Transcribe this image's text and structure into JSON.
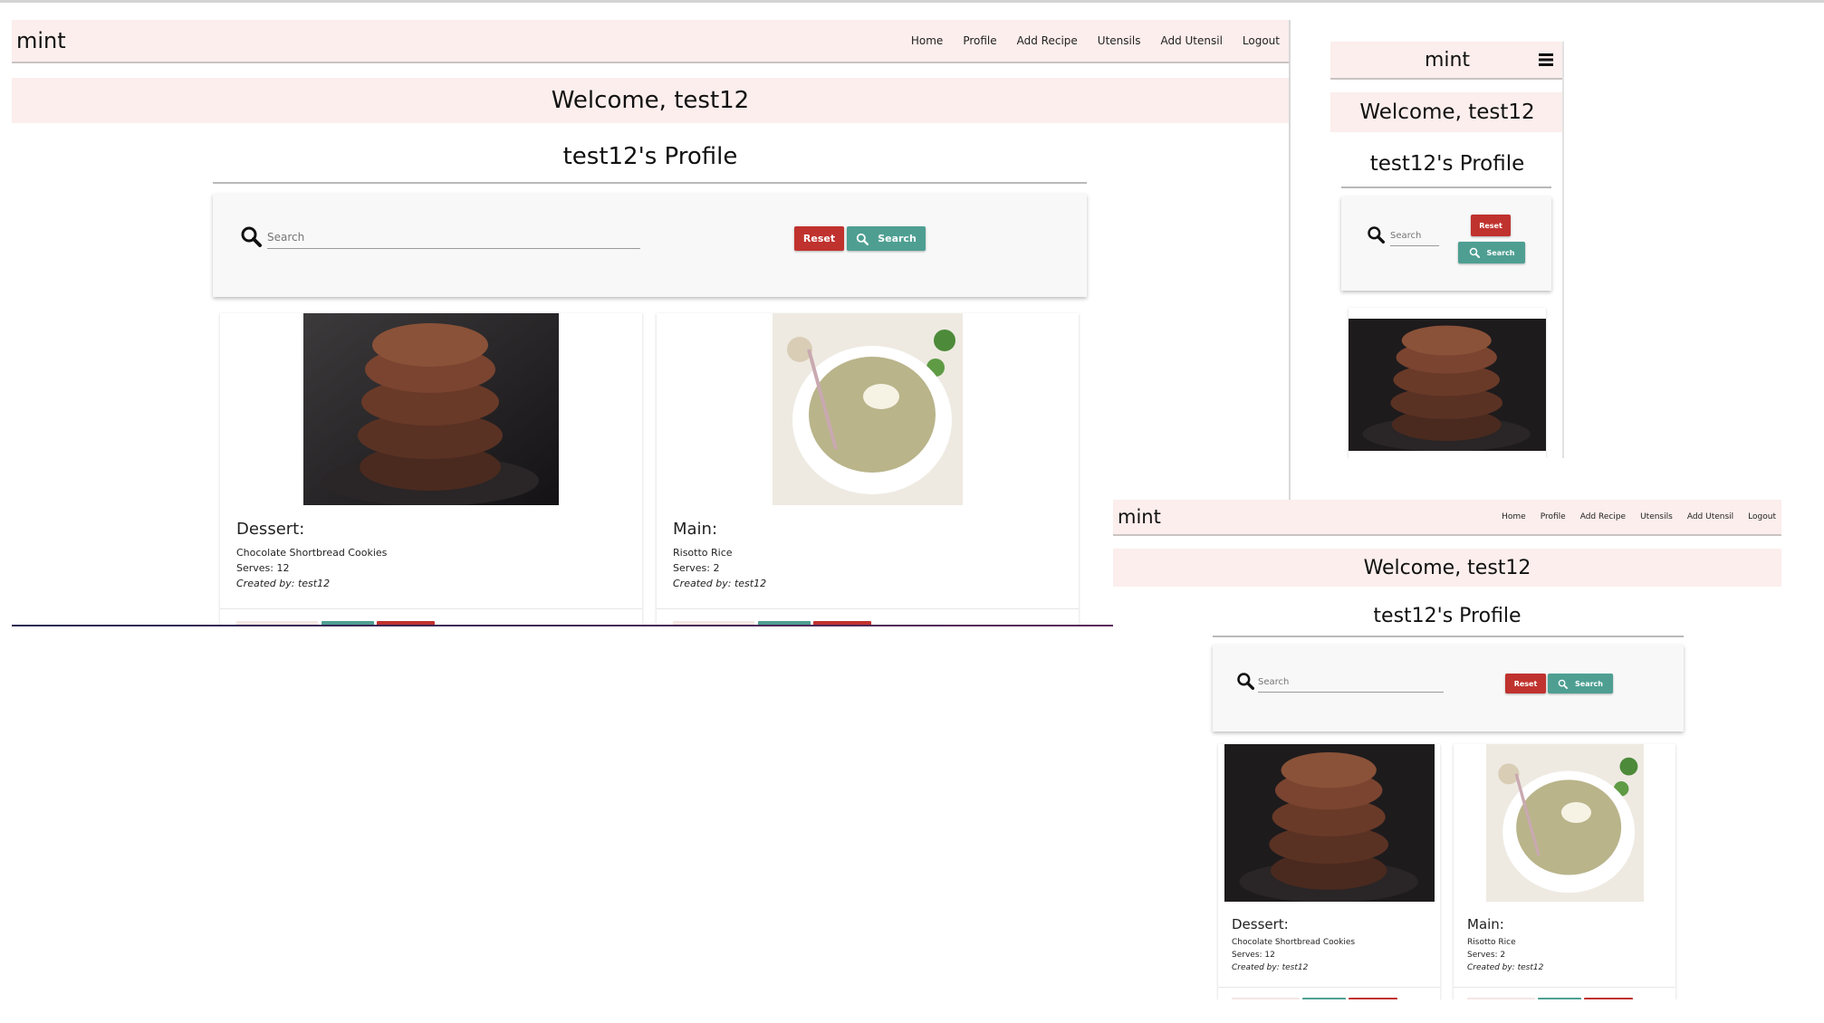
{
  "app": {
    "brand": "mint"
  },
  "nav": {
    "links": [
      "Home",
      "Profile",
      "Add Recipe",
      "Utensils",
      "Add Utensil",
      "Logout"
    ]
  },
  "welcome": "Welcome, test12",
  "profile_title": "test12's Profile",
  "search": {
    "placeholder": "Search",
    "reset_label": "Reset",
    "search_label": "Search"
  },
  "recipes": [
    {
      "category": "Dessert:",
      "name": "Chocolate Shortbread Cookies",
      "serves": "Serves: 12",
      "created_by": "Created by: test12",
      "image": "chocolate-cookies"
    },
    {
      "category": "Main:",
      "name": "Risotto Rice",
      "serves": "Serves: 2",
      "created_by": "Created by: test12",
      "image": "risotto-bowl"
    }
  ],
  "colors": {
    "nav_bg": "#fbeeec",
    "reset": "#c0322e",
    "search": "#4e9f92"
  },
  "icons": {
    "search": "search-icon",
    "menu": "hamburger-menu-icon"
  }
}
